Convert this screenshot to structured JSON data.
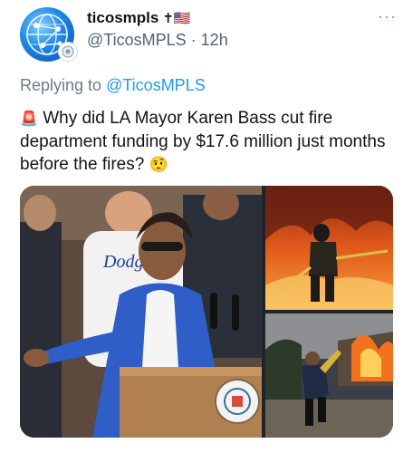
{
  "tweet": {
    "display_name": "ticosmpls",
    "name_emoji": "✝🇺🇸",
    "handle": "@TicosMPLS",
    "separator": "·",
    "time": "12h",
    "more_label": "···",
    "replying_prefix": "Replying to",
    "replying_handle": "@TicosMPLS",
    "text_emoji_start": "🚨",
    "text": "Why did LA Mayor Karen Bass cut fire department funding by $17.6 million just months before the fires?",
    "text_emoji_end": "🤨"
  },
  "media": {
    "jersey_text": "Dodgers"
  },
  "icons": {
    "avatar": "globe-network-icon",
    "avatar_badge": "badge-icon",
    "more": "more-options-icon"
  },
  "colors": {
    "link": "#1d9bf0",
    "secondary_text": "#536471",
    "text": "#0f1419"
  }
}
